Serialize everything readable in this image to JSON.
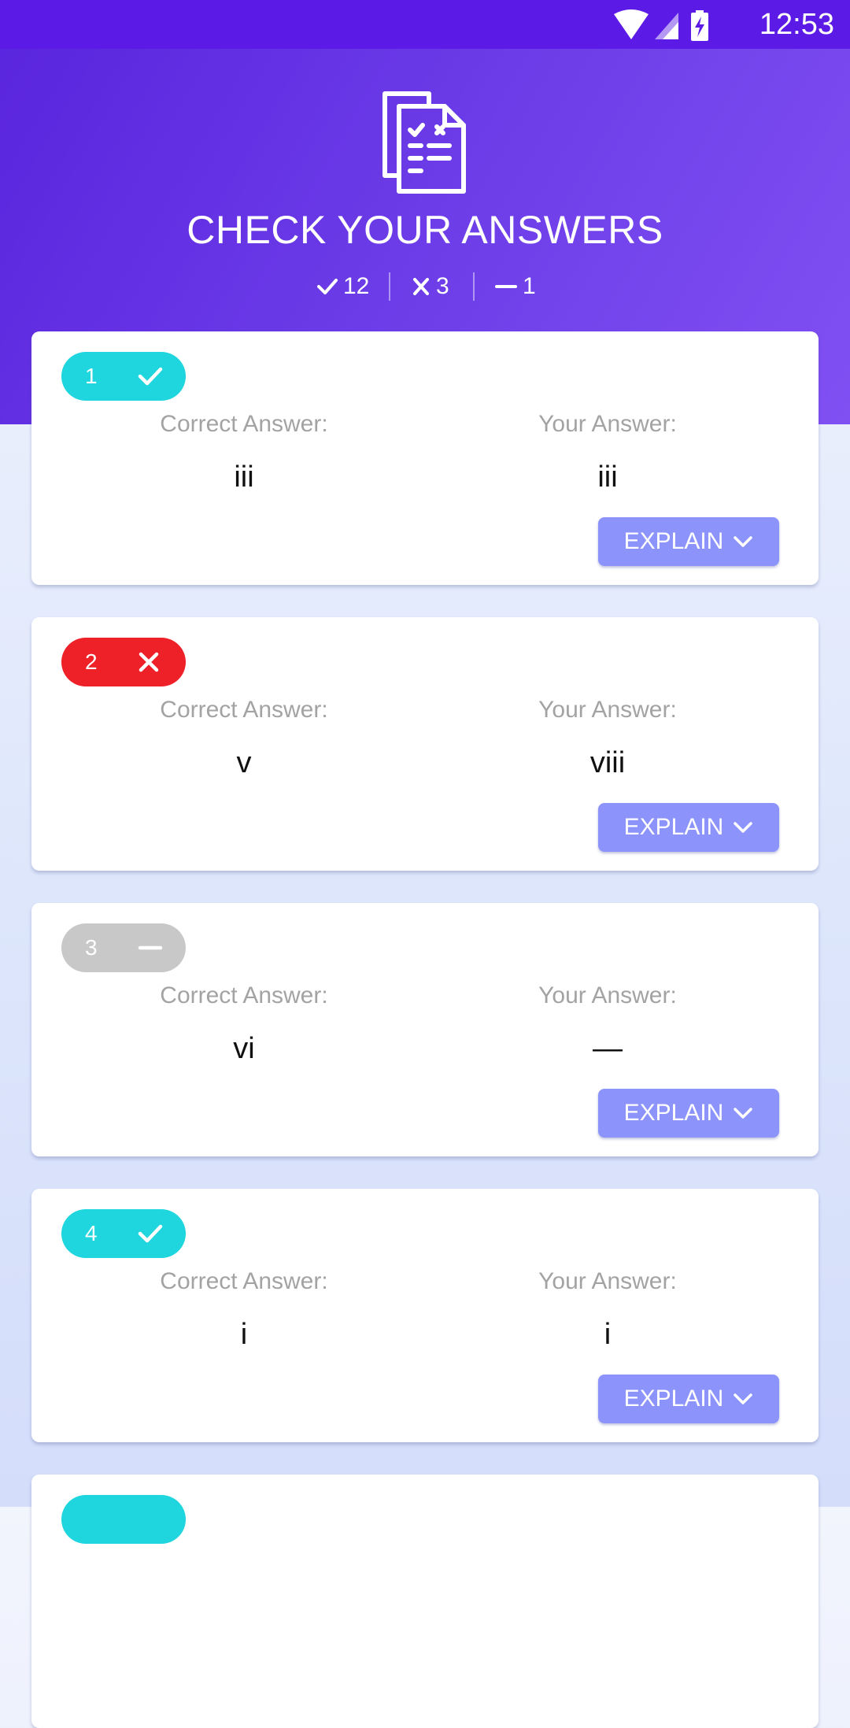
{
  "status_bar": {
    "time": "12:53"
  },
  "header": {
    "title": "CHECK YOUR ANSWERS",
    "stats": {
      "correct": "12",
      "wrong": "3",
      "skipped": "1"
    }
  },
  "labels": {
    "correct_answer": "Correct Answer:",
    "your_answer": "Your Answer:",
    "explain": "EXPLAIN"
  },
  "questions": [
    {
      "number": "1",
      "status": "correct",
      "correct_answer": "iii",
      "your_answer": "iii"
    },
    {
      "number": "2",
      "status": "wrong",
      "correct_answer": "v",
      "your_answer": "viii"
    },
    {
      "number": "3",
      "status": "skipped",
      "correct_answer": "vi",
      "your_answer": "—"
    },
    {
      "number": "4",
      "status": "correct",
      "correct_answer": "i",
      "your_answer": "i"
    },
    {
      "number": "",
      "status": "correct",
      "correct_answer": "",
      "your_answer": ""
    }
  ],
  "colors": {
    "status_bar": "#5b1ae6",
    "header_start": "#5a25de",
    "header_end": "#8150f3",
    "correct": "#1fd5de",
    "wrong": "#ee2028",
    "skipped": "#c8c8c8",
    "explain_button": "#8c93fb"
  },
  "icons": {
    "header": "document-checklist-icon",
    "correct": "check-icon",
    "wrong": "x-icon",
    "skipped": "dash-icon",
    "explain": "chevron-down-icon"
  }
}
